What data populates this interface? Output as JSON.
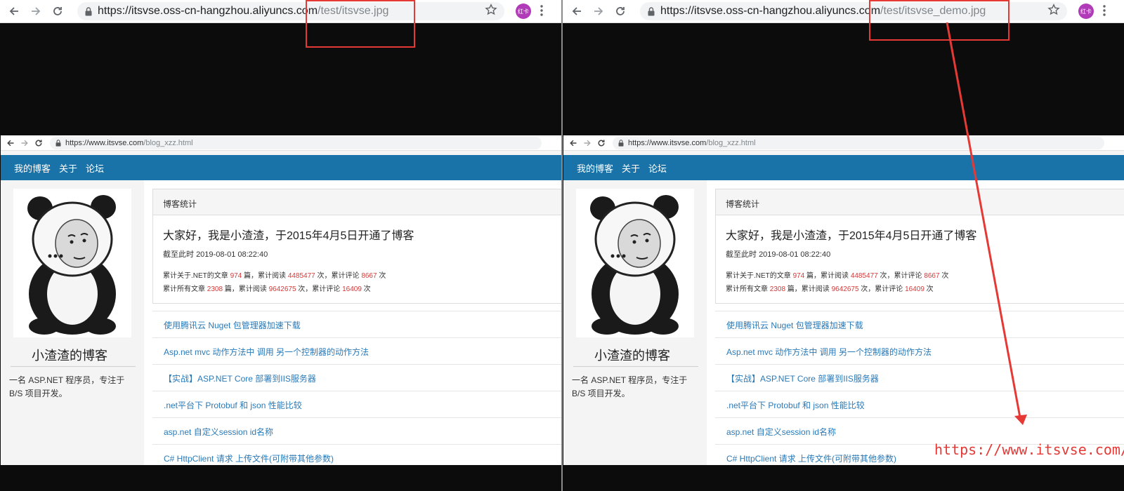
{
  "left": {
    "url_host": "https://itsvse.oss-cn-hangzhou.aliyuncs.com",
    "url_path": "/test/itsvse.jpg"
  },
  "right": {
    "url_host": "https://itsvse.oss-cn-hangzhou.aliyuncs.com",
    "url_path": "/test/itsvse_demo.jpg"
  },
  "profile_label": "红卡",
  "inner": {
    "url_host": "https://www.itsvse.com",
    "url_path": "/blog_xzz.html",
    "nav": [
      "我的博客",
      "关于",
      "论坛"
    ],
    "blog_name": "小渣渣的博客",
    "bio": "一名 ASP.NET 程序员，专注于 B/S 项目开发。",
    "stats_title": "博客统计",
    "greeting": "大家好，我是小渣渣，于2015年4月5日开通了博客",
    "as_of_label": "截至此时",
    "as_of_time": "2019-08-01 08:22:40",
    "stat1": {
      "p1": "累计关于.NET的文章 ",
      "n1": "974",
      "p2": " 篇，累计阅读 ",
      "n2": "4485477",
      "p3": " 次，累计评论 ",
      "n3": "8667",
      "p4": " 次"
    },
    "stat2": {
      "p1": "累计所有文章 ",
      "n1": "2308",
      "p2": " 篇，累计阅读 ",
      "n2": "9642675",
      "p3": " 次，累计评论 ",
      "n3": "16409",
      "p4": " 次"
    },
    "posts": [
      "使用腾讯云 Nuget 包管理器加速下载",
      "Asp.net mvc 动作方法中 调用 另一个控制器的动作方法",
      "【实战】ASP.NET Core 部署到IIS服务器",
      ".net平台下 Protobuf 和 json 性能比较",
      "asp.net 自定义session id名称",
      "C# HttpClient 请求 上传文件(可附带其他参数)"
    ]
  },
  "annotation_url": "https://www.itsvse.com/",
  "colors": {
    "highlight": "#e53935",
    "navbar": "#1a73a8",
    "link": "#2a7ab8",
    "stat_number": "#d43a3a"
  }
}
